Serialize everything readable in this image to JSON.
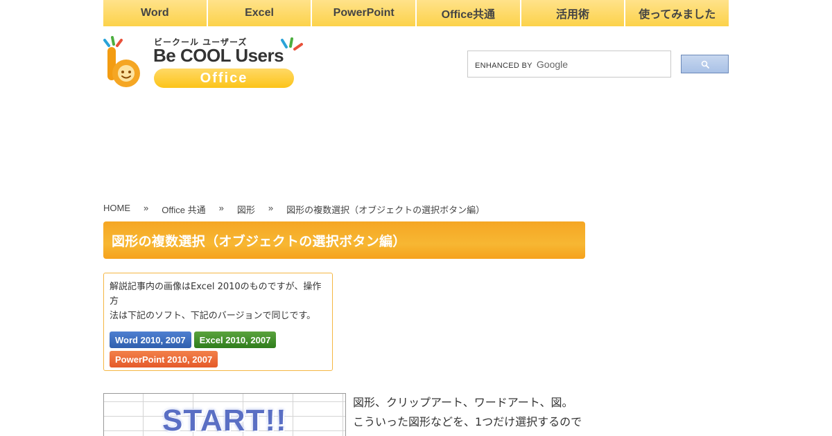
{
  "nav": {
    "items": [
      {
        "label": "Word"
      },
      {
        "label": "Excel"
      },
      {
        "label": "PowerPoint"
      },
      {
        "label": "Office共通"
      },
      {
        "label": "活用術"
      },
      {
        "label": "使ってみました"
      }
    ]
  },
  "logo": {
    "kana": "ビークール ユーザーズ",
    "title": "Be COOL Users",
    "subtitle": "Office"
  },
  "search": {
    "enhanced_label": "ENHANCED BY",
    "provider": "Google"
  },
  "breadcrumb": {
    "items": [
      "HOME",
      "Office 共通",
      "図形",
      "図形の複数選択（オブジェクトの選択ボタン編）"
    ],
    "separator": "»"
  },
  "article": {
    "title": "図形の複数選択（オブジェクトの選択ボタン編）",
    "note": {
      "line1": "解説記事内の画像はExcel 2010のものですが、操作方",
      "line2": "法は下記のソフト、下記のバージョンで同じです。"
    },
    "badges": {
      "word": "Word 2010, 2007",
      "excel": "Excel 2010, 2007",
      "ppt": "PowerPoint 2010, 2007"
    },
    "figure_text": "START!!",
    "body": {
      "line1": "図形、クリップアート、ワードアート、図。",
      "line2": "こういった図形などを、1つだけ選択するので"
    }
  },
  "colors": {
    "nav_bg": "#fcd34d",
    "title_bar": "#f7b733",
    "note_border": "#f5b642",
    "word": "#2f5fae",
    "excel": "#2f7d1c",
    "powerpoint": "#e55a2a"
  }
}
